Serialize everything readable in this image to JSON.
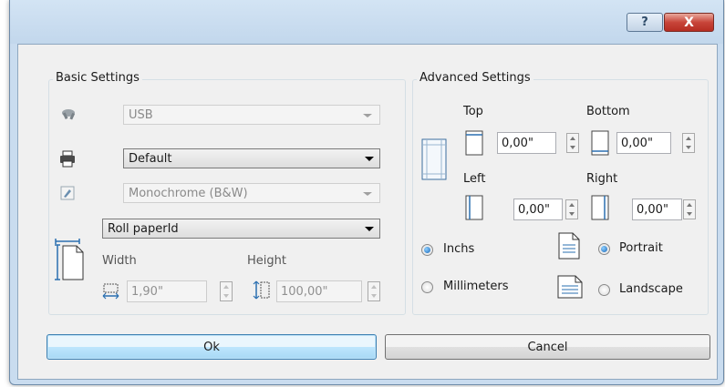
{
  "window": {
    "help_glyph": "?",
    "close_glyph": "X"
  },
  "basic": {
    "title": "Basic Settings",
    "port_value": "USB",
    "printer_value": "Default",
    "color_value": "Monochrome (B&W)",
    "paper_value": "Roll paperId",
    "width_label": "Width",
    "height_label": "Height",
    "width_value": "1,90\"",
    "height_value": "100,00\""
  },
  "advanced": {
    "title": "Advanced Settings",
    "top_label": "Top",
    "bottom_label": "Bottom",
    "left_label": "Left",
    "right_label": "Right",
    "top_value": "0,00\"",
    "bottom_value": "0,00\"",
    "left_value": "0,00\"",
    "right_value": "0,00\"",
    "units_inch": "Inchs",
    "units_mm": "Millimeters",
    "portrait": "Portrait",
    "landscape": "Landscape"
  },
  "buttons": {
    "ok": "Ok",
    "cancel": "Cancel"
  }
}
